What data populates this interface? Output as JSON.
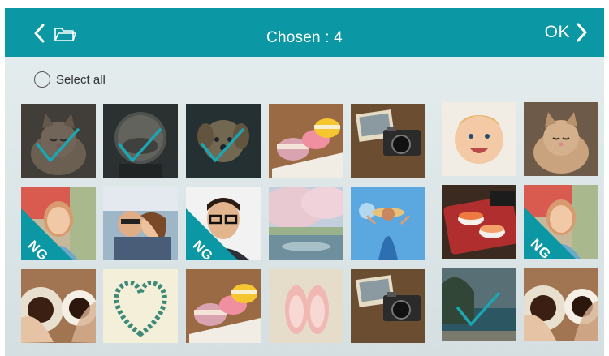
{
  "header": {
    "title": "Chosen : 4",
    "ok_label": "OK",
    "back_icon": "chevron-left-icon",
    "folder_icon": "folder-icon",
    "forward_icon": "chevron-right-icon",
    "bg_color": "#0b97a3"
  },
  "select_all": {
    "label": "Select all",
    "checked": false
  },
  "badge_text": "NG",
  "colors": {
    "accent": "#0b97a3",
    "check": "#1aa6b3"
  },
  "thumbnails": [
    {
      "subject": "kitten",
      "selected": true,
      "ng": false
    },
    {
      "subject": "crystal-ball",
      "selected": true,
      "ng": false
    },
    {
      "subject": "puppy",
      "selected": true,
      "ng": false
    },
    {
      "subject": "macarons",
      "selected": false,
      "ng": false
    },
    {
      "subject": "camera-photos",
      "selected": false,
      "ng": false
    },
    {
      "subject": "baby",
      "selected": false,
      "ng": false
    },
    {
      "subject": "kitten",
      "selected": false,
      "ng": false
    },
    {
      "subject": "woman-portrait",
      "selected": false,
      "ng": true
    },
    {
      "subject": "couple-selfie",
      "selected": false,
      "ng": false
    },
    {
      "subject": "man-with-glasses",
      "selected": false,
      "ng": true
    },
    {
      "subject": "cherry-blossom",
      "selected": false,
      "ng": false
    },
    {
      "subject": "woman-hat-sky",
      "selected": false,
      "ng": false
    },
    {
      "subject": "sushi",
      "selected": false,
      "ng": false
    },
    {
      "subject": "woman-portrait",
      "selected": false,
      "ng": true
    },
    {
      "subject": "coffee-cups",
      "selected": false,
      "ng": false
    },
    {
      "subject": "bead-heart",
      "selected": false,
      "ng": false
    },
    {
      "subject": "macarons",
      "selected": false,
      "ng": false
    },
    {
      "subject": "pink-shoes",
      "selected": false,
      "ng": false
    },
    {
      "subject": "camera-photos",
      "selected": false,
      "ng": false
    },
    {
      "subject": "beach",
      "selected": true,
      "ng": false
    },
    {
      "subject": "coffee-cups",
      "selected": false,
      "ng": false
    }
  ]
}
